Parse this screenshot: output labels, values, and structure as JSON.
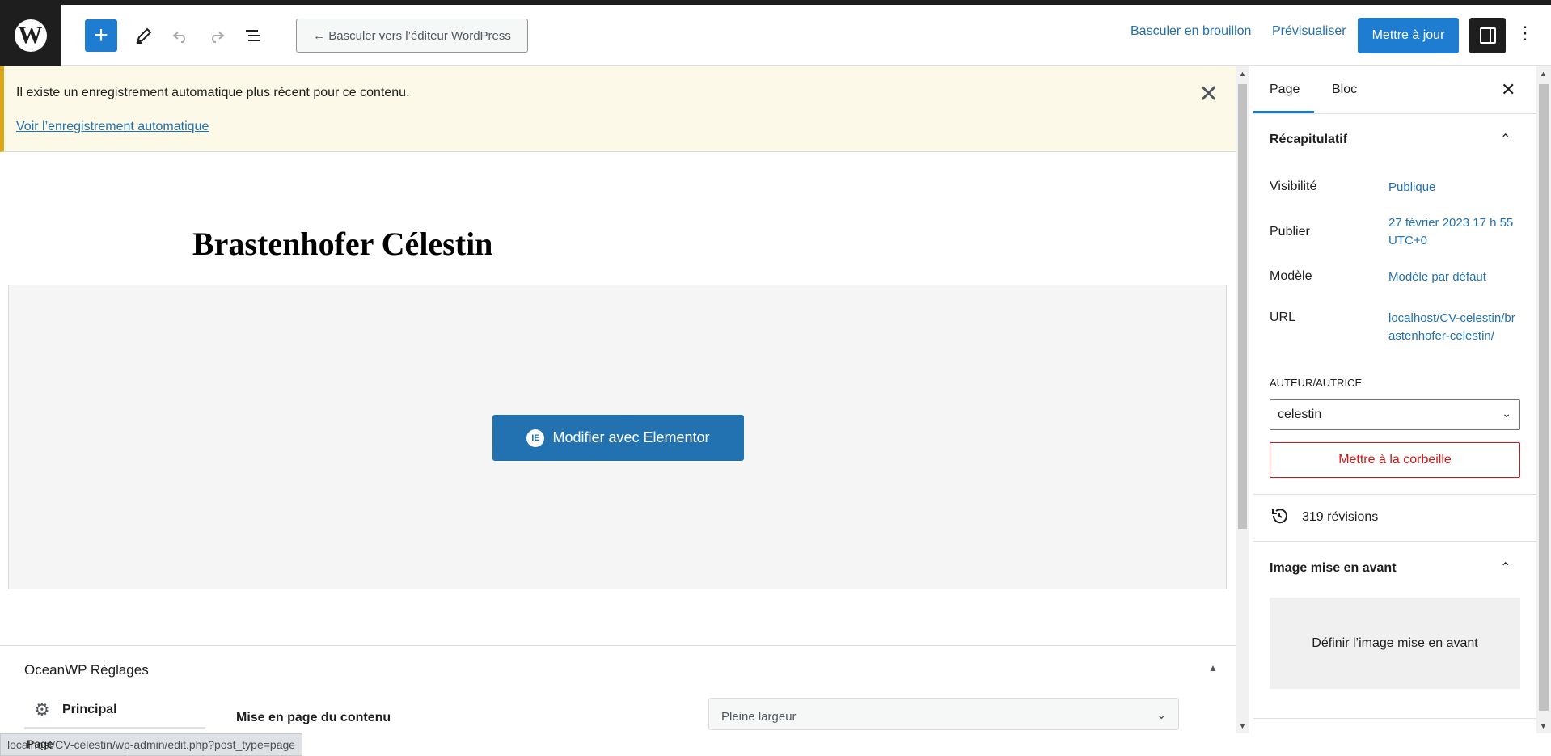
{
  "header": {
    "logo": "W",
    "add_icon": "+",
    "switch_editor_label": "← Basculer vers l’éditeur WordPress",
    "draft_label": "Basculer en brouillon",
    "preview_label": "Prévisualiser",
    "update_label": "Mettre à jour"
  },
  "notice": {
    "message": "Il existe un enregistrement automatique plus récent pour ce contenu.",
    "link": "Voir l’enregistrement automatique",
    "close": "✕"
  },
  "editor": {
    "title": "Brastenhofer Célestin",
    "elementor_button": "Modifier avec Elementor",
    "elementor_icon": "IE"
  },
  "metabox": {
    "title": "OceanWP Réglages",
    "tab_principal": "Principal",
    "field_label": "Mise en page du contenu",
    "field_value": "Pleine largeur"
  },
  "sidebar": {
    "tabs": [
      "Page",
      "Bloc"
    ],
    "summary_title": "Récapitulatif",
    "rows": [
      {
        "label": "Visibilité",
        "value": "Publique"
      },
      {
        "label": "Publier",
        "value": "27 février 2023 17 h 55 UTC+0"
      },
      {
        "label": "Modèle",
        "value": "Modèle par défaut"
      },
      {
        "label": "URL",
        "value": "localhost/CV-celestin/brastenhofer-celestin/"
      }
    ],
    "author_label": "AUTEUR/AUTRICE",
    "author_value": "celestin",
    "trash_label": "Mettre à la corbeille",
    "revisions": "319 révisions",
    "featured_title": "Image mise en avant",
    "featured_button": "Définir l’image mise en avant"
  },
  "status": {
    "url": "localhost/CV-celestin/wp-admin/edit.php?post_type=page",
    "page_label": "Page"
  },
  "colors": {
    "accent": "#1e7cd1",
    "link": "#2271b1",
    "danger": "#cc1818",
    "notice_bg": "#fcf9e8",
    "notice_border": "#dba617"
  }
}
